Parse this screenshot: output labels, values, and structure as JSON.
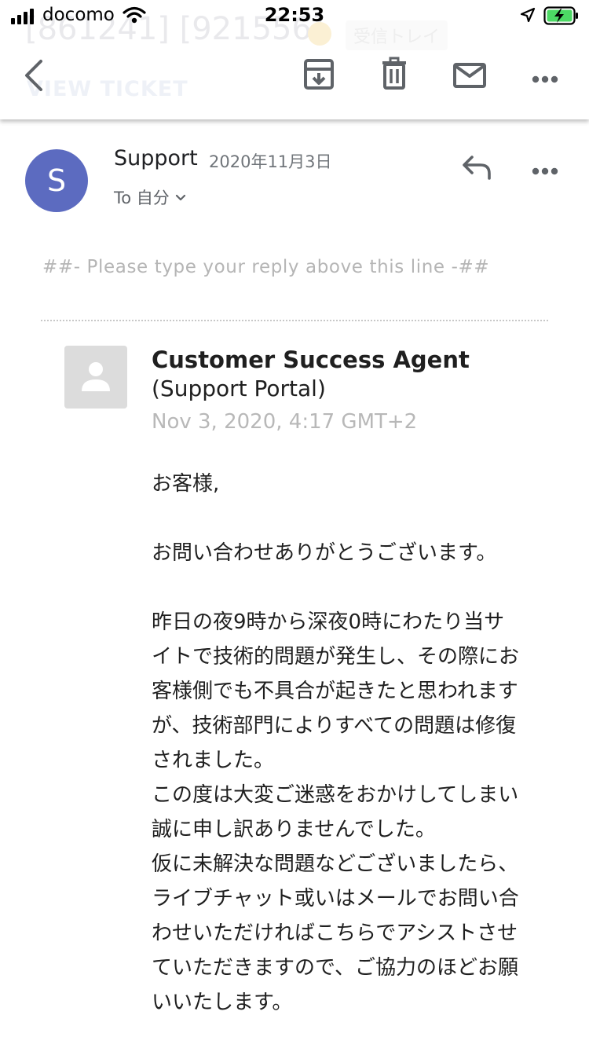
{
  "status_bar": {
    "carrier": "docomo",
    "time": "22:53",
    "icons": [
      "signal-bars-icon",
      "wifi-icon",
      "location-arrow-icon",
      "battery-charging-icon"
    ],
    "battery_color": "#4cd964"
  },
  "header": {
    "ghost_subject": "[861241] [921556]",
    "ghost_label": "受信トレイ",
    "ghost_view_ticket": "VIEW TICKET",
    "icons": [
      "back-arrow-icon",
      "archive-icon",
      "trash-icon",
      "mail-icon",
      "more-icon"
    ]
  },
  "message_header": {
    "avatar_letter": "S",
    "avatar_color": "#5c6bc0",
    "sender": "Support",
    "date": "2020年11月3日",
    "recipient": "To 自分",
    "icons": [
      "reply-icon",
      "more-icon",
      "chevron-down-icon"
    ]
  },
  "body": {
    "reply_line": "##- Please type your reply above this line -##",
    "agent": {
      "name": "Customer Success Agent",
      "portal": "(Support Portal)",
      "timestamp": "Nov 3, 2020, 4:17 GMT+2"
    },
    "greeting": "お客様,",
    "thanks": "お問い合わせありがとうございます。",
    "paragraph_lines": [
      "昨日の夜9時から深夜0時にわたり当サ",
      "イトで技術的問題が発生し、その際にお",
      "客様側でも不具合が起きたと思われます",
      "が、技術部門によりすべての問題は修復",
      "されました。",
      "この度は大変ご迷惑をおかけしてしまい",
      "誠に申し訳ありませんでした。",
      "仮に未解決な問題などございましたら、",
      "ライブチャット或いはメールでお問い合",
      "わせいただければこちらでアシストさせ",
      "ていただきますので、ご協力のほどお願",
      "いいたします。"
    ]
  }
}
